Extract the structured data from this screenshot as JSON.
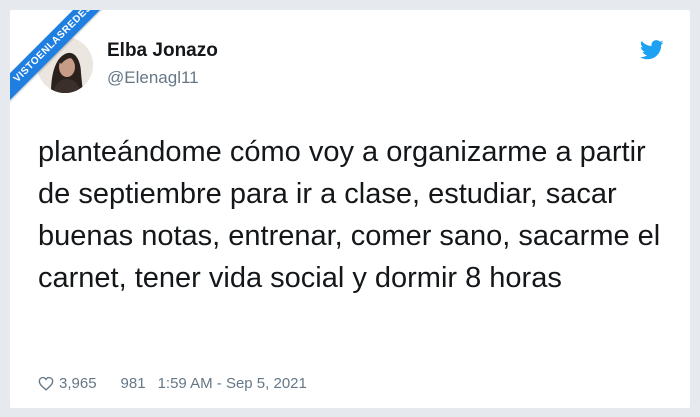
{
  "watermark": {
    "text": "VISTOENLASREDES"
  },
  "tweet": {
    "author_name": "Elba Jonazo",
    "author_handle": "@Elenagl11",
    "text": "planteándome cómo voy a organizarme a partir de septiembre para ir a clase, estudiar, sacar buenas notas, entrenar, comer sano, sacarme el carnet, tener vida social y dormir 8 horas",
    "likes": "3,965",
    "retweets": "981",
    "timestamp": "1:59 AM - Sep 5, 2021"
  },
  "icons": {
    "logo": "twitter-bird-icon",
    "like": "heart-icon",
    "avatar": "profile-photo"
  },
  "colors": {
    "brand_blue": "#1da1f2",
    "ribbon_blue": "#1f7fe0",
    "text_primary": "#14171a",
    "text_secondary": "#657786"
  }
}
